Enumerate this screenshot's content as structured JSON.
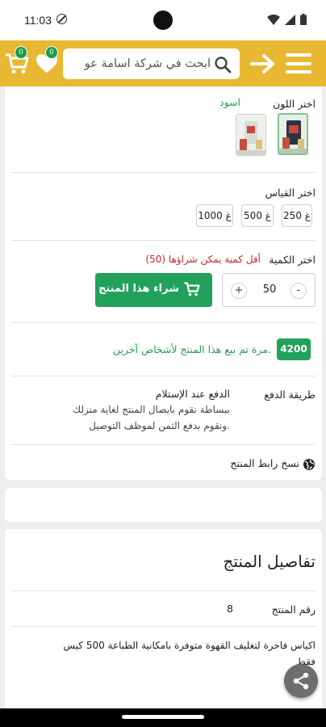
{
  "status_bar": {
    "time": "11:03"
  },
  "header": {
    "search_placeholder": "ابحث في شركة اسامة عو",
    "favorites_count": "0",
    "cart_count": "0"
  },
  "product": {
    "color_label": "اختر اللون",
    "color_value": "اسود",
    "size_label": "اختر القياس",
    "sizes": [
      "250 غ",
      "500 غ",
      "1000 غ"
    ],
    "quantity_label": "اختر الكمية",
    "min_quantity_note": "أقل كمية يمكن شراؤها (50)",
    "quantity": "50",
    "qty_minus": "-",
    "qty_plus": "+",
    "buy_label": "شراء هذا المنتج",
    "sold_count": "4200",
    "sold_text": "مرة تم بيع هذا المنتج لأشخاص آخرين.",
    "payment_label": "طريقة الدفع",
    "payment_method": "الدفع عند الإستلام",
    "payment_desc_line1": "ببساطة نقوم بايصال المنتج لغاية منزلك",
    "payment_desc_line2": "ونقوم بدفع الثمن لموظف التوصيل.",
    "copy_link": "نسخ رابط المنتج"
  },
  "details": {
    "title": "تفاصيل المنتج",
    "product_number_label": "رقم المنتج",
    "product_number": "8",
    "description_line1": "اكياس فاخرة لتغليف القهوة متوفرة بامكانية الطباعة 500 كيس",
    "description_line2": "فقط"
  },
  "colors": {
    "accent": "#e9b833",
    "green": "#21a15a",
    "red": "#c62828",
    "badge": "#1b9a4c"
  }
}
